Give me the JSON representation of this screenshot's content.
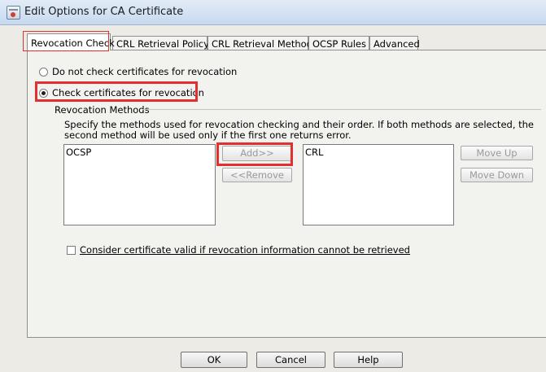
{
  "window": {
    "title": "Edit Options for CA Certificate"
  },
  "tabs": [
    {
      "label": "Revocation Check",
      "active": true
    },
    {
      "label": "CRL Retrieval Policy"
    },
    {
      "label": "CRL Retrieval Method"
    },
    {
      "label": "OCSP Rules"
    },
    {
      "label": "Advanced"
    }
  ],
  "revocation": {
    "option_no_check": "Do not check certificates for revocation",
    "option_check": "Check certificates for revocation",
    "selected": "check"
  },
  "methods": {
    "group_label": "Revocation Methods",
    "description": "Specify the methods used for revocation checking and their order. If both methods are selected, the second method will be used only if the first one returns error.",
    "available": [
      "OCSP"
    ],
    "selected": [
      "CRL"
    ],
    "add_label": "Add>>",
    "remove_label": "<<Remove",
    "move_up_label": "Move Up",
    "move_down_label": "Move Down"
  },
  "consider_valid": {
    "label": "Consider certificate valid if revocation information cannot be retrieved",
    "checked": false
  },
  "footer": {
    "ok": "OK",
    "cancel": "Cancel",
    "help": "Help"
  },
  "colors": {
    "highlight": "#e03030",
    "background": "#ecebe6"
  }
}
